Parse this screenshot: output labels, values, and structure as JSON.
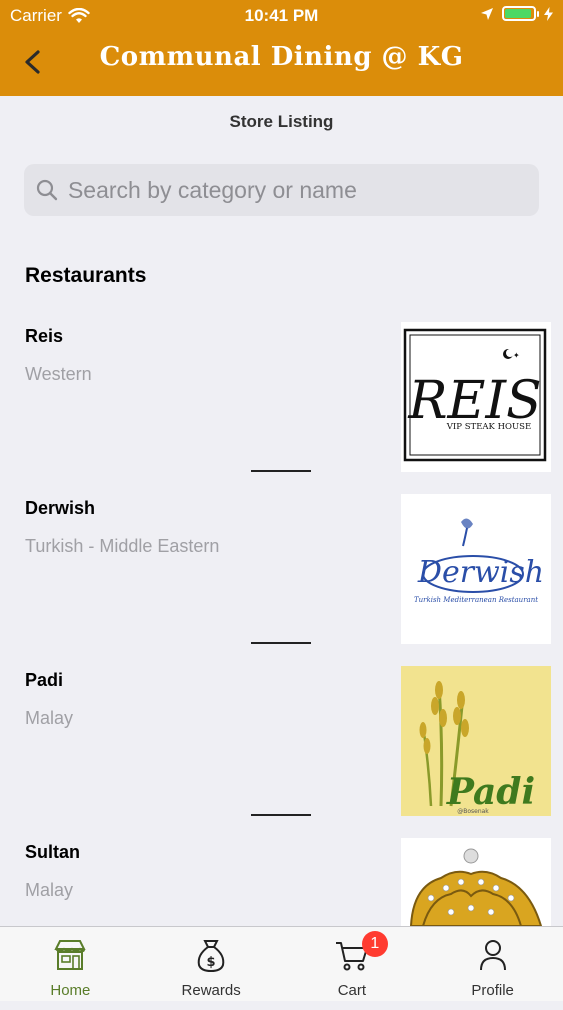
{
  "status_bar": {
    "carrier": "Carrier",
    "time": "10:41 PM",
    "battery_color": "#4cd964"
  },
  "header": {
    "title": "Communal Dining @ KG",
    "back_icon": "chevron-left-icon",
    "background": "#db8d0a"
  },
  "subtitle": "Store Listing",
  "search": {
    "placeholder": "Search by category or name",
    "value": ""
  },
  "section_title": "Restaurants",
  "restaurants": [
    {
      "name": "Reis",
      "category": "Western",
      "logo_text": "REIS",
      "logo_subtext": "VIP STEAK HOUSE"
    },
    {
      "name": "Derwish",
      "category": "Turkish - Middle Eastern",
      "logo_text": "Derwish",
      "logo_subtext": "Turkish Mediterranean Restaurant"
    },
    {
      "name": "Padi",
      "category": "Malay",
      "logo_text": "Padi",
      "logo_subtext": "@Bosenak"
    },
    {
      "name": "Sultan",
      "category": "Malay",
      "logo_text": "",
      "logo_subtext": ""
    }
  ],
  "tabs": [
    {
      "label": "Home",
      "icon": "storefront-icon",
      "active": true
    },
    {
      "label": "Rewards",
      "icon": "money-bag-icon",
      "active": false
    },
    {
      "label": "Cart",
      "icon": "cart-icon",
      "active": false,
      "badge": "1"
    },
    {
      "label": "Profile",
      "icon": "person-icon",
      "active": false
    }
  ],
  "colors": {
    "accent": "#db8d0a",
    "active_tab": "#5a7d2a",
    "badge": "#ff3b30"
  }
}
